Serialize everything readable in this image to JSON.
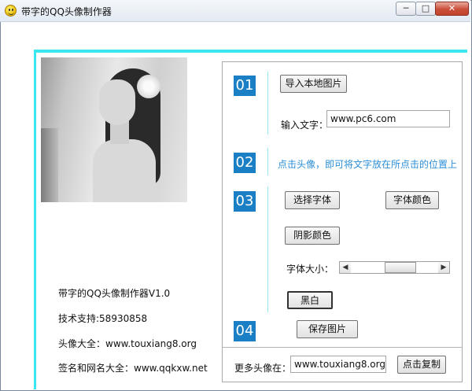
{
  "window": {
    "title": "带字的QQ头像制作器",
    "controls": {
      "minimize": "─",
      "maximize": "□",
      "close": "✕"
    }
  },
  "left": {
    "app_name": "带字的QQ头像制作器V1.0",
    "support": "技术支持:58930858",
    "avatar_site": "头像大全：www.touxiang8.org",
    "names_site": "签名和网名大全：www.qqkxw.net"
  },
  "steps": [
    "01",
    "02",
    "03",
    "04"
  ],
  "step1": {
    "import_button": "导入本地图片",
    "text_label": "输入文字：",
    "text_value": "www.pc6.com"
  },
  "step2": {
    "hint": "点击头像，即可将文字放在所点击的位置上"
  },
  "step3": {
    "font_button": "选择字体",
    "font_color_button": "字体颜色",
    "shadow_color_button": "阴影颜色",
    "font_size_label": "字体大小：",
    "bw_button": "黑白"
  },
  "step4": {
    "save_button": "保存图片"
  },
  "footer": {
    "more_label": "更多头像在：",
    "url_value": "www.touxiang8.org",
    "copy_button": "点击复制"
  },
  "colors": {
    "accent": "#3ce6ee",
    "step_badge": "#1a7fc4",
    "hint_text": "#2b8fd6"
  }
}
